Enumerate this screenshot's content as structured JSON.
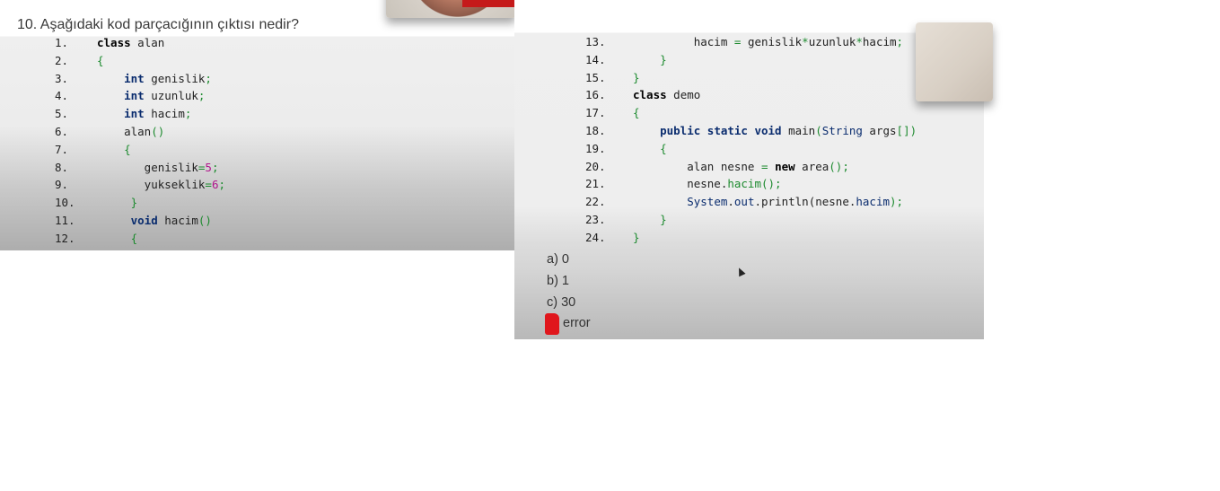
{
  "question": "10. Aşağıdaki kod parçacığının çıktısı nedir?",
  "answers": {
    "a": "a) 0",
    "b": "b) 1",
    "c": "c) 30",
    "d": "error"
  },
  "code_left": [
    {
      "n": "1.",
      "tokens": [
        {
          "t": "class",
          "c": "kw"
        },
        {
          "t": " alan",
          "c": ""
        }
      ]
    },
    {
      "n": "2.",
      "tokens": [
        {
          "t": "{",
          "c": "pu"
        }
      ]
    },
    {
      "n": "3.",
      "tokens": [
        {
          "t": "    ",
          "c": ""
        },
        {
          "t": "int",
          "c": "kw ty"
        },
        {
          "t": " genislik",
          "c": ""
        },
        {
          "t": ";",
          "c": "pu"
        }
      ]
    },
    {
      "n": "4.",
      "tokens": [
        {
          "t": "    ",
          "c": ""
        },
        {
          "t": "int",
          "c": "kw ty"
        },
        {
          "t": " uzunluk",
          "c": ""
        },
        {
          "t": ";",
          "c": "pu"
        }
      ]
    },
    {
      "n": "5.",
      "tokens": [
        {
          "t": "    ",
          "c": ""
        },
        {
          "t": "int",
          "c": "kw ty"
        },
        {
          "t": " hacim",
          "c": ""
        },
        {
          "t": ";",
          "c": "pu"
        }
      ]
    },
    {
      "n": "6.",
      "tokens": [
        {
          "t": "    alan",
          "c": ""
        },
        {
          "t": "()",
          "c": "pu"
        }
      ]
    },
    {
      "n": "7.",
      "tokens": [
        {
          "t": "    ",
          "c": ""
        },
        {
          "t": "{",
          "c": "pu"
        }
      ]
    },
    {
      "n": "8.",
      "tokens": [
        {
          "t": "       genislik",
          "c": ""
        },
        {
          "t": "=",
          "c": "pu"
        },
        {
          "t": "5",
          "c": "nu"
        },
        {
          "t": ";",
          "c": "pu"
        }
      ]
    },
    {
      "n": "9.",
      "tokens": [
        {
          "t": "       yukseklik",
          "c": ""
        },
        {
          "t": "=",
          "c": "pu"
        },
        {
          "t": "6",
          "c": "nu"
        },
        {
          "t": ";",
          "c": "pu"
        }
      ]
    },
    {
      "n": "10.",
      "tokens": [
        {
          "t": "     ",
          "c": ""
        },
        {
          "t": "}",
          "c": "pu"
        }
      ]
    },
    {
      "n": "11.",
      "tokens": [
        {
          "t": "     ",
          "c": ""
        },
        {
          "t": "void",
          "c": "kw ty"
        },
        {
          "t": " hacim",
          "c": ""
        },
        {
          "t": "()",
          "c": "pu"
        }
      ]
    },
    {
      "n": "12.",
      "tokens": [
        {
          "t": "     ",
          "c": ""
        },
        {
          "t": "{",
          "c": "pu"
        }
      ]
    }
  ],
  "code_right": [
    {
      "n": "13.",
      "tokens": [
        {
          "t": "         hacim ",
          "c": ""
        },
        {
          "t": "=",
          "c": "pu"
        },
        {
          "t": " genislik",
          "c": ""
        },
        {
          "t": "*",
          "c": "pu"
        },
        {
          "t": "uzunluk",
          "c": ""
        },
        {
          "t": "*",
          "c": "pu"
        },
        {
          "t": "hacim",
          "c": ""
        },
        {
          "t": ";",
          "c": "pu"
        }
      ]
    },
    {
      "n": "14.",
      "tokens": [
        {
          "t": "    ",
          "c": ""
        },
        {
          "t": "}",
          "c": "pu"
        }
      ]
    },
    {
      "n": "15.",
      "tokens": [
        {
          "t": "}",
          "c": "pu"
        }
      ]
    },
    {
      "n": "16.",
      "tokens": [
        {
          "t": "class",
          "c": "kw"
        },
        {
          "t": " demo",
          "c": ""
        }
      ]
    },
    {
      "n": "17.",
      "tokens": [
        {
          "t": "{",
          "c": "pu"
        }
      ]
    },
    {
      "n": "18.",
      "tokens": [
        {
          "t": "    ",
          "c": ""
        },
        {
          "t": "public static void",
          "c": "kw ty"
        },
        {
          "t": " main",
          "c": ""
        },
        {
          "t": "(",
          "c": "pu"
        },
        {
          "t": "String",
          "c": "ty"
        },
        {
          "t": " args",
          "c": ""
        },
        {
          "t": "[])",
          "c": "pu"
        }
      ]
    },
    {
      "n": "19.",
      "tokens": [
        {
          "t": "    ",
          "c": ""
        },
        {
          "t": "{",
          "c": "pu"
        }
      ]
    },
    {
      "n": "20.",
      "tokens": [
        {
          "t": "        alan nesne ",
          "c": ""
        },
        {
          "t": "=",
          "c": "pu"
        },
        {
          "t": " ",
          "c": ""
        },
        {
          "t": "new",
          "c": "kw"
        },
        {
          "t": " area",
          "c": ""
        },
        {
          "t": "();",
          "c": "pu"
        }
      ]
    },
    {
      "n": "21.",
      "tokens": [
        {
          "t": "        nesne.",
          "c": ""
        },
        {
          "t": "hacim",
          "c": "pu"
        },
        {
          "t": "();",
          "c": "pu"
        }
      ]
    },
    {
      "n": "22.",
      "tokens": [
        {
          "t": "        ",
          "c": ""
        },
        {
          "t": "System",
          "c": "ty"
        },
        {
          "t": ".",
          "c": ""
        },
        {
          "t": "out",
          "c": "ty"
        },
        {
          "t": ".println(nesne.",
          "c": ""
        },
        {
          "t": "hacim",
          "c": "ty"
        },
        {
          "t": ");",
          "c": "pu"
        }
      ]
    },
    {
      "n": "23.",
      "tokens": [
        {
          "t": "    ",
          "c": ""
        },
        {
          "t": "}",
          "c": "pu"
        }
      ]
    },
    {
      "n": "24.",
      "tokens": [
        {
          "t": "}",
          "c": "pu"
        }
      ]
    }
  ],
  "colors": {
    "keyword": "#000000",
    "type": "#0a2c6e",
    "punct": "#1c8a2e",
    "number": "#b0158c",
    "marker": "#e0161c"
  },
  "icons": {
    "answer_marker": "red-marker-icon",
    "cursor": "mouse-cursor-icon"
  }
}
